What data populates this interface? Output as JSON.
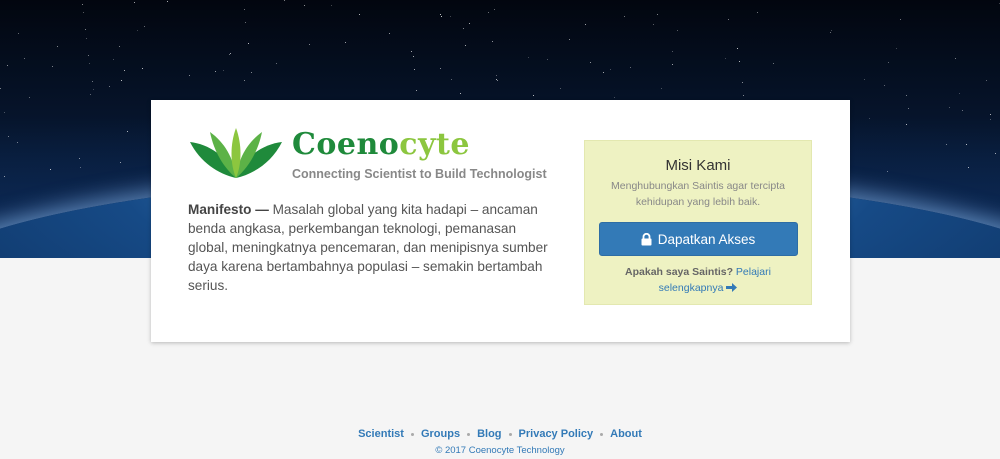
{
  "brand": {
    "name_part1": "Coeno",
    "name_part2": "cyte",
    "tagline": "Connecting Scientist to Build Technologist"
  },
  "manifesto": {
    "label": "Manifesto —",
    "text": "Masalah global yang kita hadapi – ancaman benda angkasa, perkembangan teknologi, pemanasan global, meningkatnya pencemaran, dan menipisnya sumber daya karena bertambahnya populasi – semakin bertambah serius."
  },
  "mission": {
    "title": "Misi Kami",
    "description": "Menghubungkan Saintis agar tercipta kehidupan yang lebih baik.",
    "button_label": "Dapatkan Akses",
    "question": "Apakah saya Saintis?",
    "learn_more": "Pelajari selengkapnya"
  },
  "footer": {
    "links": [
      "Scientist",
      "Groups",
      "Blog",
      "Privacy Policy",
      "About"
    ],
    "copyright": "© 2017 Coenocyte Technology"
  },
  "colors": {
    "brand_green": "#1f8a3b",
    "brand_lightgreen": "#8cc63f",
    "button_blue": "#337ab7",
    "mission_bg": "#eef2c2"
  }
}
